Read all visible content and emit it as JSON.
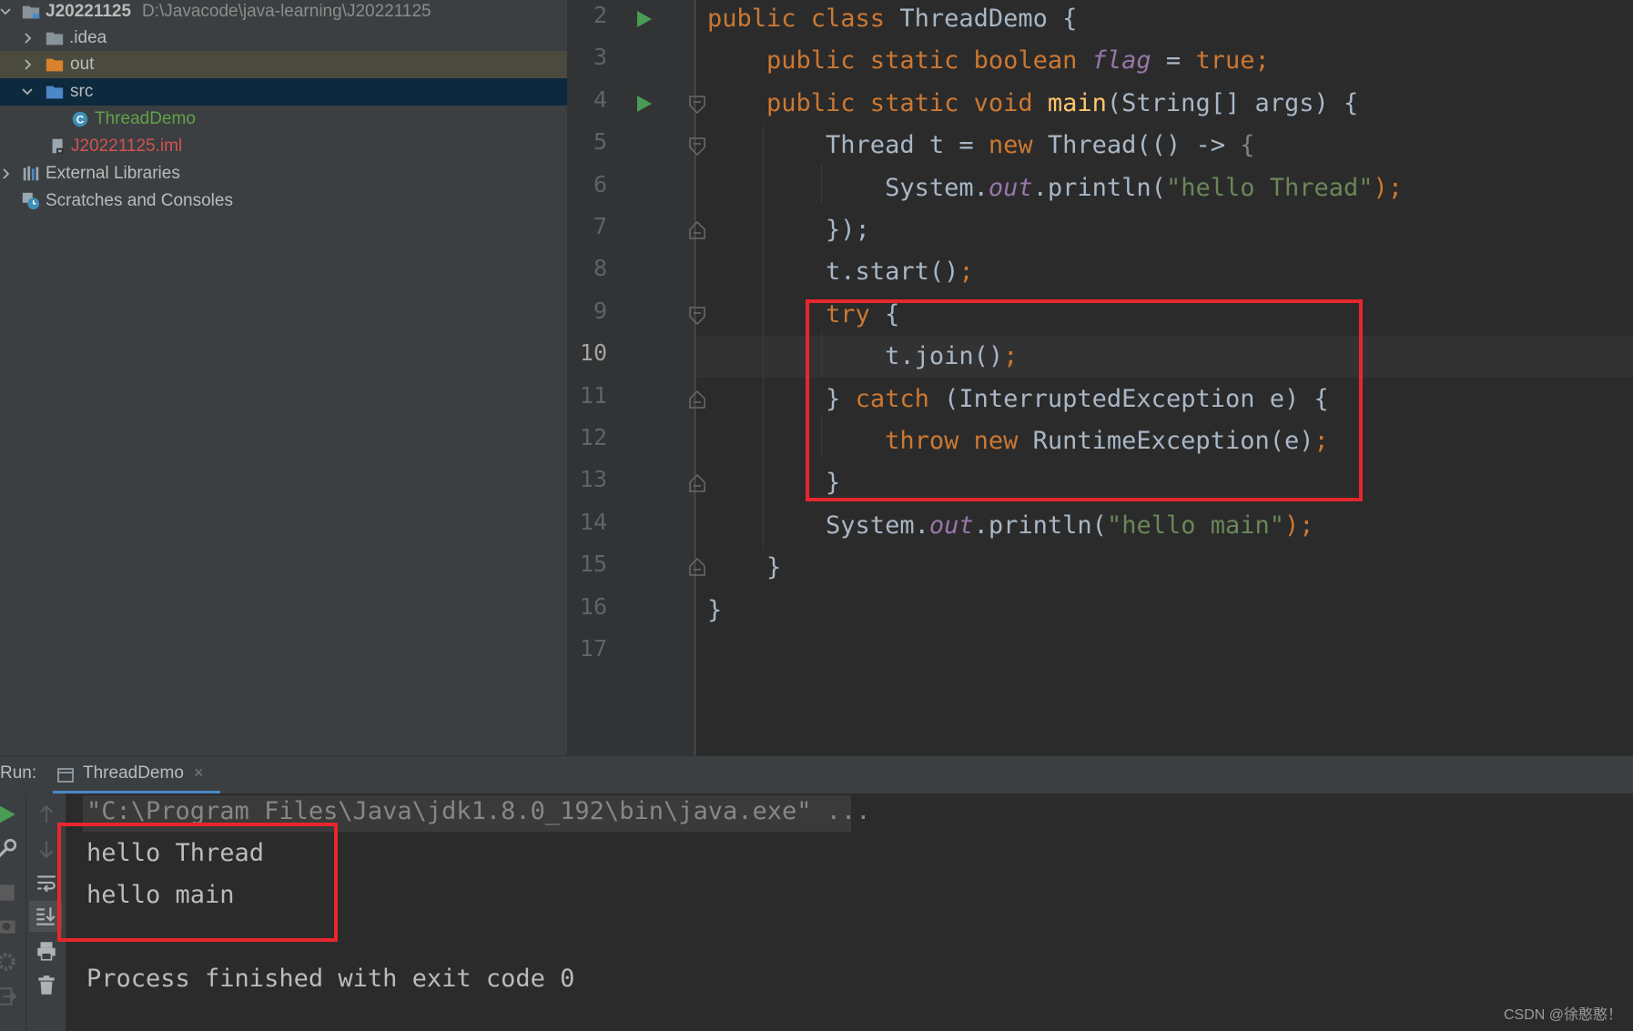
{
  "project_tree": {
    "root_name": "J20221125",
    "root_path": "D:\\Javacode\\java-learning\\J20221125",
    "items": [
      {
        "label": "idea_label",
        "text": ".idea"
      },
      {
        "label": "out_label",
        "text": "out"
      },
      {
        "label": "src_label",
        "text": "src"
      },
      {
        "label": "threaddemo_label",
        "text": "ThreadDemo"
      },
      {
        "label": "iml_label",
        "text": "J20221125.iml"
      },
      {
        "label": "extlib_label",
        "text": "External Libraries"
      },
      {
        "label": "scratches_label",
        "text": "Scratches and Consoles"
      }
    ]
  },
  "editor": {
    "line_numbers": [
      "2",
      "3",
      "4",
      "5",
      "6",
      "7",
      "8",
      "9",
      "10",
      "11",
      "12",
      "13",
      "14",
      "15",
      "16",
      "17"
    ],
    "current_line": "10",
    "code": [
      [
        {
          "t": "public class ",
          "c": "kw"
        },
        {
          "t": "ThreadDemo {",
          "c": ""
        }
      ],
      [
        {
          "t": "    public static boolean ",
          "c": "kw"
        },
        {
          "t": "flag",
          "c": "fld"
        },
        {
          "t": " = ",
          "c": ""
        },
        {
          "t": "true;",
          "c": "kw"
        }
      ],
      [
        {
          "t": "    public static void ",
          "c": "kw"
        },
        {
          "t": "main",
          "c": "fn"
        },
        {
          "t": "(String[] args) {",
          "c": ""
        }
      ],
      [
        {
          "t": "        Thread t = ",
          "c": ""
        },
        {
          "t": "new ",
          "c": "kw"
        },
        {
          "t": "Thread(() -> ",
          "c": ""
        },
        {
          "t": "{",
          "c": "br-g"
        }
      ],
      [
        {
          "t": "            System.",
          "c": ""
        },
        {
          "t": "out",
          "c": "fld"
        },
        {
          "t": ".println(",
          "c": ""
        },
        {
          "t": "\"hello Thread\"",
          "c": "str"
        },
        {
          "t": ");",
          "c": "kw"
        }
      ],
      [
        {
          "t": "        });",
          "c": ""
        }
      ],
      [
        {
          "t": "        t.start()",
          "c": ""
        },
        {
          "t": ";",
          "c": "kw"
        }
      ],
      [
        {
          "t": "        try ",
          "c": "kw"
        },
        {
          "t": "{",
          "c": ""
        }
      ],
      [
        {
          "t": "            t.join()",
          "c": ""
        },
        {
          "t": ";",
          "c": "kw"
        }
      ],
      [
        {
          "t": "        } ",
          "c": ""
        },
        {
          "t": "catch ",
          "c": "kw"
        },
        {
          "t": "(InterruptedException e) {",
          "c": ""
        }
      ],
      [
        {
          "t": "            throw new ",
          "c": "kw"
        },
        {
          "t": "RuntimeException(e)",
          "c": ""
        },
        {
          "t": ";",
          "c": "kw"
        }
      ],
      [
        {
          "t": "        }",
          "c": ""
        }
      ],
      [
        {
          "t": "        System.",
          "c": ""
        },
        {
          "t": "out",
          "c": "fld"
        },
        {
          "t": ".println(",
          "c": ""
        },
        {
          "t": "\"hello main\"",
          "c": "str"
        },
        {
          "t": ");",
          "c": "kw"
        }
      ],
      [
        {
          "t": "    }",
          "c": ""
        }
      ],
      [
        {
          "t": "}",
          "c": ""
        }
      ],
      []
    ]
  },
  "run_panel": {
    "run_label": "Run:",
    "tab_label": "ThreadDemo",
    "console": {
      "command": "\"C:\\Program Files\\Java\\jdk1.8.0_192\\bin\\java.exe\" ...",
      "out1": "hello Thread",
      "out2": "hello main",
      "exit": "Process finished with exit code 0"
    }
  },
  "watermark": "CSDN @徐憨憨！",
  "colors": {
    "accent_highlight": "#e8262d",
    "keyword": "#cc7832",
    "string": "#6a8759",
    "field": "#9876aa",
    "function": "#ffc66d"
  }
}
